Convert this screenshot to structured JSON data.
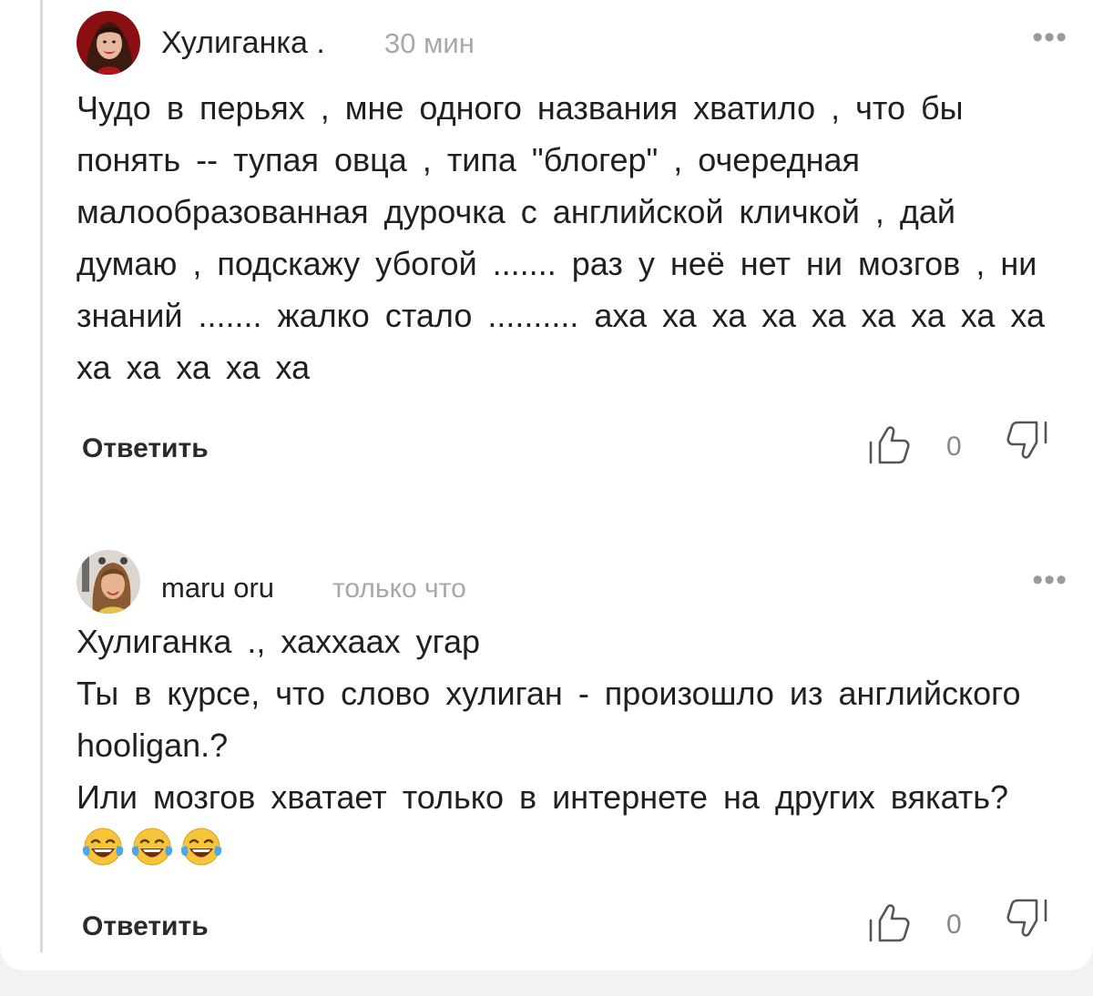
{
  "comments": [
    {
      "author": "Хулиганка .",
      "time": "30 мин",
      "more": "•••",
      "text": "Чудо в перьях  , мне  одного  названия  хватило , что бы  понять  --  тупая  овца  , типа  \"блогер\" ,   очередная  малообразованная  дурочка     с английской   кличкой , дай  думаю  , подскажу убогой  .......  раз  у  неё  нет  ни мозгов ,  ни  знаний ....... жалко стало  ..........  аха ха ха ха ха ха ха ха ха ха ха ха ха ха",
      "reply_label": "Ответить",
      "likes": "0",
      "avatar_icon": "woman-portrait-icon"
    },
    {
      "author": "maru oru",
      "time": "только что",
      "more": "•••",
      "text": "Хулиганка ., хаххаах угар\nТы в курсе, что слово хулиган - произошло из английского hooligan.?\nИли мозгов хватает только в интернете на других вякать?",
      "emoji": "😂😂😂",
      "reply_label": "Ответить",
      "likes": "0",
      "avatar_icon": "woman-selfie-icon"
    }
  ],
  "icons": {
    "like": "thumbs-up-icon",
    "dislike": "thumbs-down-icon",
    "emoji": "tears-of-joy-icon"
  },
  "colors": {
    "muted": "#a8a8ac",
    "text": "#202020",
    "thread_line": "#d9d9dd"
  }
}
